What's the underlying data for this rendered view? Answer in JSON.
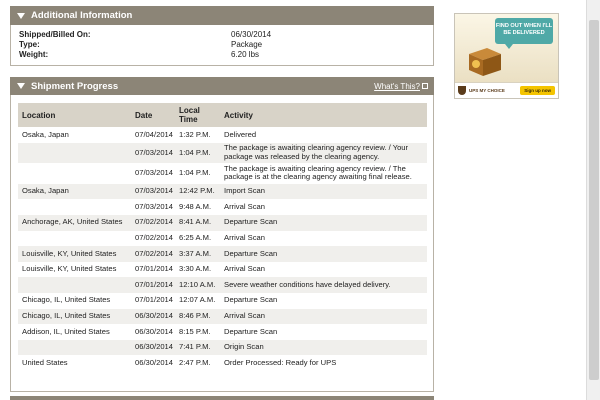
{
  "additional_info": {
    "title": "Additional Information",
    "rows": [
      {
        "label": "Shipped/Billed On:",
        "value": "06/30/2014"
      },
      {
        "label": "Type:",
        "value": "Package"
      },
      {
        "label": "Weight:",
        "value": "6.20 lbs"
      }
    ]
  },
  "shipment_progress": {
    "title": "Shipment Progress",
    "whats_this": "What's This?",
    "headers": {
      "location": "Location",
      "date": "Date",
      "local_time": "Local Time",
      "activity": "Activity"
    },
    "rows": [
      {
        "location": "Osaka, Japan",
        "date": "07/04/2014",
        "time": "1:32 P.M.",
        "activity": "Delivered"
      },
      {
        "location": "",
        "date": "07/03/2014",
        "time": "1:04 P.M.",
        "activity": "The package is awaiting clearing agency review. / Your package was released by the clearing agency."
      },
      {
        "location": "",
        "date": "07/03/2014",
        "time": "1:04 P.M.",
        "activity": "The package is awaiting clearing agency review. / The package is at the clearing agency awaiting final release."
      },
      {
        "location": "Osaka, Japan",
        "date": "07/03/2014",
        "time": "12:42 P.M.",
        "activity": "Import Scan"
      },
      {
        "location": "",
        "date": "07/03/2014",
        "time": "9:48 A.M.",
        "activity": "Arrival Scan"
      },
      {
        "location": "Anchorage, AK, United States",
        "date": "07/02/2014",
        "time": "8:41 A.M.",
        "activity": "Departure Scan"
      },
      {
        "location": "",
        "date": "07/02/2014",
        "time": "6:25 A.M.",
        "activity": "Arrival Scan"
      },
      {
        "location": "Louisville, KY, United States",
        "date": "07/02/2014",
        "time": "3:37 A.M.",
        "activity": "Departure Scan"
      },
      {
        "location": "Louisville, KY, United States",
        "date": "07/01/2014",
        "time": "3:30 A.M.",
        "activity": "Arrival Scan"
      },
      {
        "location": "",
        "date": "07/01/2014",
        "time": "12:10 A.M.",
        "activity": "Severe weather conditions have delayed delivery."
      },
      {
        "location": "Chicago, IL, United States",
        "date": "07/01/2014",
        "time": "12:07 A.M.",
        "activity": "Departure Scan"
      },
      {
        "location": "Chicago, IL, United States",
        "date": "06/30/2014",
        "time": "8:46 P.M.",
        "activity": "Arrival Scan"
      },
      {
        "location": "Addison, IL, United States",
        "date": "06/30/2014",
        "time": "8:15 P.M.",
        "activity": "Departure Scan"
      },
      {
        "location": "",
        "date": "06/30/2014",
        "time": "7:41 P.M.",
        "activity": "Origin Scan"
      },
      {
        "location": "United States",
        "date": "06/30/2014",
        "time": "2:47 P.M.",
        "activity": "Order Processed: Ready for UPS"
      }
    ]
  },
  "promo": {
    "headline": "FIND OUT WHEN I'LL BE DELIVERED",
    "brand": "UPS MY CHOICE",
    "signup_label": "Sign up now"
  }
}
